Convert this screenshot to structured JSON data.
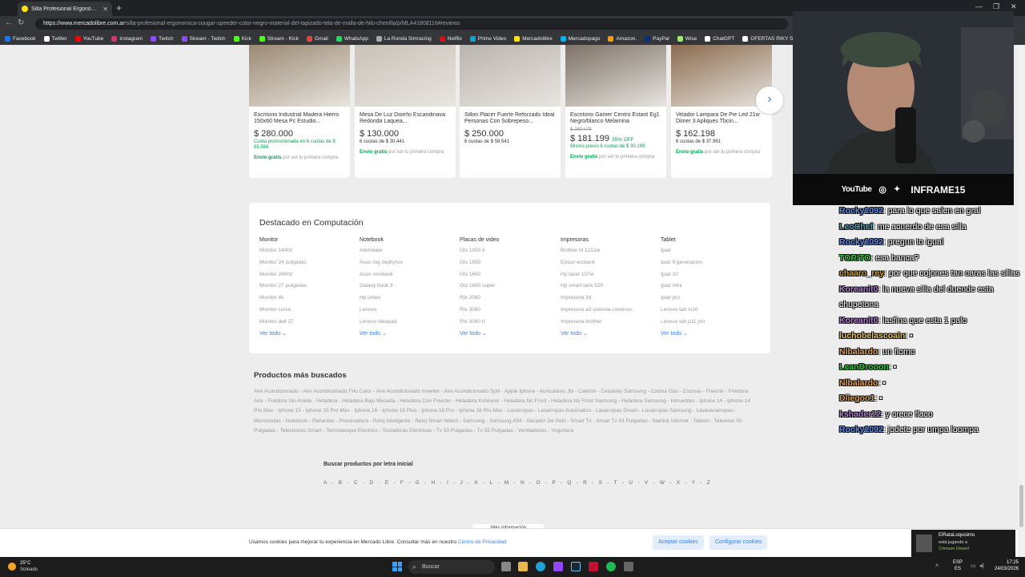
{
  "browser": {
    "tab_title": "Silla Profesional Ergonómica Cougar",
    "url_domain": "https://www.mercadolibre.com.ar",
    "url_path": "/silla-profesional-ergonomica-cougar-speeder-color-negro-material-del-tapizado-tela-de-malla-de-hilo-chenilla/p/MLA41808116#reviews",
    "bookmarks": [
      {
        "label": "Facebook",
        "color": "#1877f2"
      },
      {
        "label": "Twitter",
        "color": "#ffffff"
      },
      {
        "label": "YouTube",
        "color": "#ff0000"
      },
      {
        "label": "Instagram",
        "color": "#e1306c"
      },
      {
        "label": "Twitch",
        "color": "#9146ff"
      },
      {
        "label": "Stream - Twitch",
        "color": "#9146ff"
      },
      {
        "label": "Kick",
        "color": "#53fc18"
      },
      {
        "label": "Stream - Kick",
        "color": "#53fc18"
      },
      {
        "label": "Gmail",
        "color": "#ea4335"
      },
      {
        "label": "WhatsApp",
        "color": "#25d366"
      },
      {
        "label": "La Ronda Simracing",
        "color": "#aaaaaa"
      },
      {
        "label": "Netflix",
        "color": "#e50914"
      },
      {
        "label": "Prime Video",
        "color": "#00a8e1"
      },
      {
        "label": "Mercadolibre",
        "color": "#ffe600"
      },
      {
        "label": "Mercadopago",
        "color": "#00b1ea"
      },
      {
        "label": "Amazon.",
        "color": "#ff9900"
      },
      {
        "label": "PayPal",
        "color": "#003087"
      },
      {
        "label": "Wise",
        "color": "#9fe870"
      },
      {
        "label": "ChatGPT",
        "color": "#ffffff"
      },
      {
        "label": "OFERTAS RIKY STE...",
        "color": "#ffffff"
      }
    ]
  },
  "carousel": [
    {
      "title": "Escritorio Industrial Madera Hierro 150x60 Mesa Pc Estudio...",
      "old": "",
      "price": "$ 280.000",
      "off": "",
      "installments": "Cuota promocionada en 6 cuotas de $ 65.566",
      "green_inst": true,
      "ship_bold": "Envío gratis",
      "ship_rest": " por ser tu primera compra",
      "img": "#9b8a73"
    },
    {
      "title": "Mesa De Luz Diseño Escandinava Redonda Laquea...",
      "old": "",
      "price": "$ 130.000",
      "off": "",
      "installments": "6 cuotas de $ 30.441",
      "green_inst": false,
      "ship_bold": "Envío gratis",
      "ship_rest": " por ser tu primera compra",
      "img": "#c9c2b8"
    },
    {
      "title": "Sillon Placer Fuerte Reforzado Ideal Personas Con Sobrepeso...",
      "old": "",
      "price": "$ 250.000",
      "off": "",
      "installments": "6 cuotas de $ 58.541",
      "green_inst": false,
      "ship_bold": "",
      "ship_rest": "",
      "img": "#b9b4ad"
    },
    {
      "title": "Escritorio Gamer Centro Estant Eg1 Negro/blanco Melamina",
      "old": "$ 280.479",
      "price": "$ 181.199",
      "off": "35% OFF",
      "installments": "Mismo precio 6 cuotas de $ 30.199",
      "green_inst": true,
      "ship_bold": "Envío gratis",
      "ship_rest": " por ser tu primera compra",
      "img": "#7d7267"
    },
    {
      "title": "Velador Lampara De Pie Led 21w Dimer 3 Apliques Tbcin...",
      "old": "",
      "price": "$ 162.198",
      "off": "",
      "installments": "6 cuotas de $ 37.981",
      "green_inst": false,
      "ship_bold": "Envío gratis",
      "ship_rest": " por ser tu primera compra",
      "img": "#8a6b4e"
    }
  ],
  "destacado": {
    "title": "Destacado en Computación",
    "ver_todo": "Ver todo",
    "columns": [
      {
        "header": "Monitor",
        "items": [
          "Monitor 144hz",
          "Monitor 24 pulgadas",
          "Monitor 240hz",
          "Monitor 27 pulgadas",
          "Monitor 4k",
          "Monitor curvo",
          "Monitor dell 27"
        ]
      },
      {
        "header": "Notebook",
        "items": [
          "Alienware",
          "Asus rog zephyrus",
          "Asus vivobook",
          "Galaxy book 3",
          "Hp omen",
          "Lenovo",
          "Lenovo ideapad"
        ]
      },
      {
        "header": "Placas de video",
        "items": [
          "Gtx 1050 ti",
          "Gtx 1650",
          "Gtx 1660",
          "Gtx 1660 super",
          "Rtx 2060",
          "Rtx 3060",
          "Rtx 3060 ti"
        ]
      },
      {
        "header": "Impresoras",
        "items": [
          "Brother hl 1212w",
          "Epson ecotank",
          "Hp laser 107w",
          "Hp smart tank 520",
          "Impresora 3d",
          "Impresora a3 sistema continuo",
          "Impresora brother"
        ]
      },
      {
        "header": "Tablet",
        "items": [
          "Ipad",
          "Ipad 9 generacion",
          "Ipad 10",
          "Ipad mini",
          "Ipad pro",
          "Lenovo tab m10",
          "Lenovo tab p11 pro"
        ]
      }
    ]
  },
  "mas_buscados": {
    "title": "Productos más buscados",
    "text": "Aire Acondicionado - Aire Acondicionado Frio Calor - Aire Acondicionado Inverter - Aire Acondicionado Split - Apple Iphone - Auriculares Jbl - Calefon - Celulares Samsung - Cocina Gas - Cocinas - Freezer - Freidora Aire - Freidora Sin Aceite - Heladera - Heladera Bajo Mesada - Heladera Con Freezer - Heladera Kohinoor - Heladera No Frost - Heladera No Frost Samsung - Heladera Samsung - Inmuebles - Iphone 14 - Iphone 14 Pro Max - Iphone 15 - Iphone 15 Pro Max - Iphone 16 - Iphone 16 Plus - Iphone 16 Pro - Iphone 16 Pro Max - Lavarropas - Lavarropas Automatico - Lavarropas Drean - Lavarropas Samsung - Lavasecarropas - Microondas - Notebook - Parlantes - Procesadora - Reloj Inteligente - Reloj Smart Watch - Samsung - Samsung A54 - Secador De Pelo - Smart Tv - Smart Tv 43 Pulgadas - Starlink Internet - Tablets - Televisor 50 Pulgadas - Televisores Smart - Termotanque Electrico - Tostadoras Electricas - Tv 50 Pulgadas - Tv 55 Pulgadas - Ventiladores - Yogurtera",
    "letras_title": "Buscar productos por letra inicial",
    "letras": "A - B - C - D - E - F - G - H - I - J - K - L - M - N - O - P - Q - R - S - T - U - V - W - X - Y - Z",
    "mas_info": "Más información"
  },
  "cookies": {
    "text": "Usamos cookies para mejorar tu experiencia en Mercado Libre. Consultar más en nuestro ",
    "link": "Centro de Privacidad",
    "accept": "Aceptar cookies",
    "configure": "Configurar cookies"
  },
  "stream": {
    "channel": "INFRAME15",
    "youtube": "YouTube",
    "chat": [
      {
        "user": "Rocky1092",
        "color": "#5b8def",
        "text": ": para lo que salen en gral"
      },
      {
        "user": "LeoChef",
        "color": "#3aa6c9",
        "text": ": me acuerdo de esa silla"
      },
      {
        "user": "Rocky1092",
        "color": "#5b8def",
        "text": ": pregun to igual"
      },
      {
        "user": "TORITO",
        "color": "#2ecc40",
        "text": ": esa banca?"
      },
      {
        "user": "chaaro_rey",
        "color": "#d4a017",
        "text": ": por que cojones tan caras las sillas"
      },
      {
        "user": "Koreanit0",
        "color": "#b07cd8",
        "text": ": la nueva silla del duende esta chupetona"
      },
      {
        "user": "Koreanit0",
        "color": "#b07cd8",
        "text": ": lasfina que esta 1 palo"
      },
      {
        "user": "luchobelascoain",
        "color": "#e8c547",
        "text": ": ▪"
      },
      {
        "user": "Nlbalardo",
        "color": "#e0a04a",
        "text": ": un fiomo"
      },
      {
        "user": "LeanDrooon",
        "color": "#2ecc40",
        "text": ": ▪"
      },
      {
        "user": "Nlbalardo",
        "color": "#e0a04a",
        "text": ": ▪"
      },
      {
        "user": "Diiegoo1",
        "color": "#e0a04a",
        "text": ": ▪"
      },
      {
        "user": "kshader12",
        "color": "#b07cd8",
        "text": ": y crece flaco"
      },
      {
        "user": "Rocky1092",
        "color": "#5b8def",
        "text": ": jodete por umpa loompa"
      }
    ],
    "notif_user": "ElRataLoquisimo",
    "notif_line1": "está jugando a",
    "notif_line2": "Crimson Desert"
  },
  "taskbar": {
    "weather_temp": "25°C",
    "weather_desc": "Soleado",
    "search": "Buscar",
    "lang": "ESP",
    "lang2": "ES",
    "time": "17:25",
    "date": "24/03/2026"
  }
}
